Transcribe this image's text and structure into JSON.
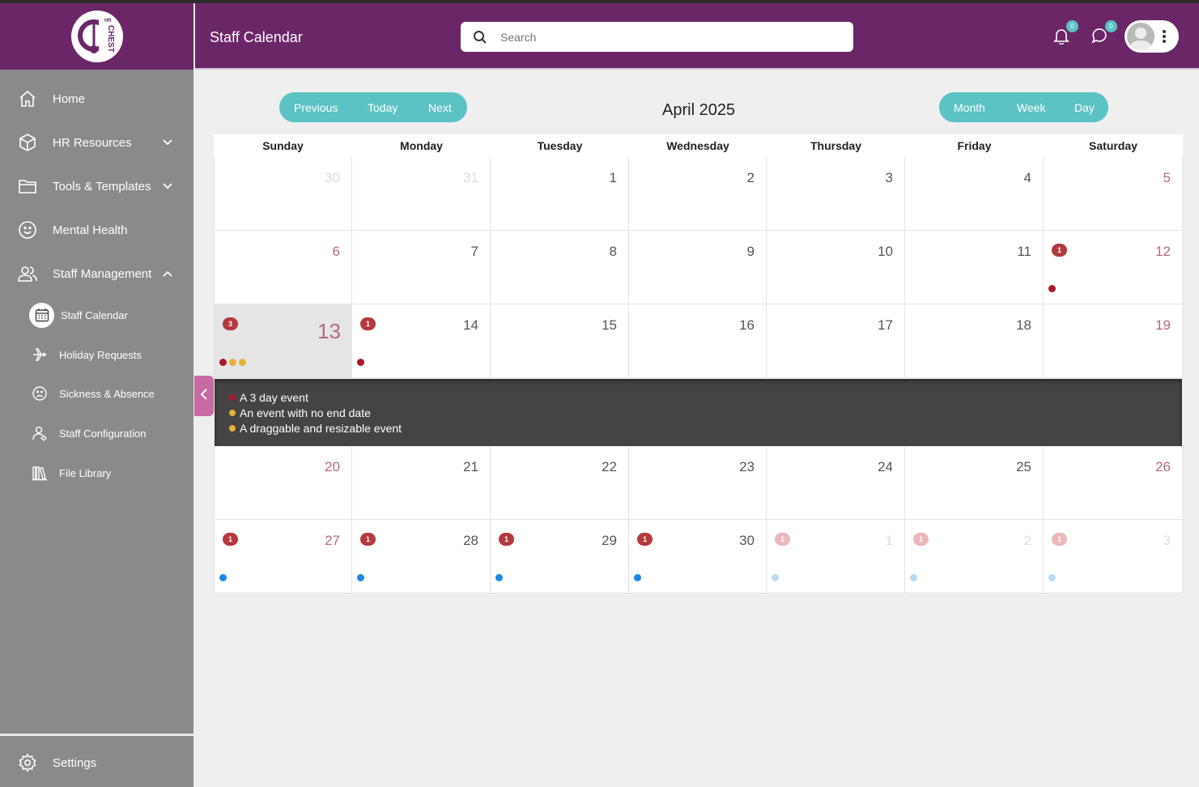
{
  "app": {
    "title": "Staff Calendar"
  },
  "search": {
    "placeholder": "Search"
  },
  "notifications": {
    "bell_count": "0",
    "chat_count": "0"
  },
  "sidebar": {
    "logo_text": "HR CHEST",
    "items": [
      {
        "label": "Home",
        "icon": "home-icon"
      },
      {
        "label": "HR Resources",
        "icon": "box-icon"
      },
      {
        "label": "Tools & Templates",
        "icon": "folder-icon"
      },
      {
        "label": "Mental Health",
        "icon": "smile-icon"
      },
      {
        "label": "Staff Management",
        "icon": "users-icon"
      }
    ],
    "subitems": [
      {
        "label": "Staff Calendar",
        "icon": "calendar-icon",
        "active": true
      },
      {
        "label": "Holiday Requests",
        "icon": "plane-icon"
      },
      {
        "label": "Sickness & Absence",
        "icon": "sad-face-icon"
      },
      {
        "label": "Staff Configuration",
        "icon": "user-gear-icon"
      },
      {
        "label": "File Library",
        "icon": "library-icon"
      }
    ],
    "settings_label": "Settings"
  },
  "toolbar": {
    "previous": "Previous",
    "today": "Today",
    "next": "Next",
    "month_title": "April 2025",
    "month": "Month",
    "week": "Week",
    "day": "Day"
  },
  "calendar": {
    "weekdays": [
      "Sunday",
      "Monday",
      "Tuesday",
      "Wednesday",
      "Thursday",
      "Friday",
      "Saturday"
    ],
    "weeks": [
      [
        {
          "d": "30",
          "o": true
        },
        {
          "d": "31",
          "o": true
        },
        {
          "d": "1"
        },
        {
          "d": "2"
        },
        {
          "d": "3"
        },
        {
          "d": "4"
        },
        {
          "d": "5"
        }
      ],
      [
        {
          "d": "6"
        },
        {
          "d": "7"
        },
        {
          "d": "8"
        },
        {
          "d": "9"
        },
        {
          "d": "10"
        },
        {
          "d": "11"
        },
        {
          "d": "12",
          "c": "1",
          "dots": [
            "#a8192a"
          ]
        }
      ],
      [
        {
          "d": "13",
          "today": true,
          "c": "3",
          "dots": [
            "#a8192a",
            "#e8b233",
            "#e8b233"
          ]
        },
        {
          "d": "14",
          "c": "1",
          "dots": [
            "#a8192a"
          ]
        },
        {
          "d": "15"
        },
        {
          "d": "16"
        },
        {
          "d": "17"
        },
        {
          "d": "18"
        },
        {
          "d": "19"
        }
      ],
      [
        {
          "d": "20"
        },
        {
          "d": "21"
        },
        {
          "d": "22"
        },
        {
          "d": "23"
        },
        {
          "d": "24"
        },
        {
          "d": "25"
        },
        {
          "d": "26"
        }
      ],
      [
        {
          "d": "27",
          "c": "1",
          "dots": [
            "#1e88e5"
          ]
        },
        {
          "d": "28",
          "c": "1",
          "dots": [
            "#1e88e5"
          ]
        },
        {
          "d": "29",
          "c": "1",
          "dots": [
            "#1e88e5"
          ]
        },
        {
          "d": "30",
          "c": "1",
          "dots": [
            "#1e88e5"
          ]
        },
        {
          "d": "1",
          "o": true,
          "c": "1",
          "dots": [
            "#b9dbf5"
          ]
        },
        {
          "d": "2",
          "o": true,
          "c": "1",
          "dots": [
            "#b9dbf5"
          ]
        },
        {
          "d": "3",
          "o": true,
          "c": "1",
          "dots": [
            "#b9dbf5"
          ]
        }
      ]
    ],
    "expanded_events": [
      {
        "label": "A 3 day event",
        "color": "#a8192a"
      },
      {
        "label": "An event with no end date",
        "color": "#e8b233"
      },
      {
        "label": "A draggable and resizable event",
        "color": "#e8b233"
      }
    ]
  },
  "colors": {
    "brand": "#6b2668",
    "accent": "#5cc2c4",
    "sidebar": "#8a8a8a"
  }
}
